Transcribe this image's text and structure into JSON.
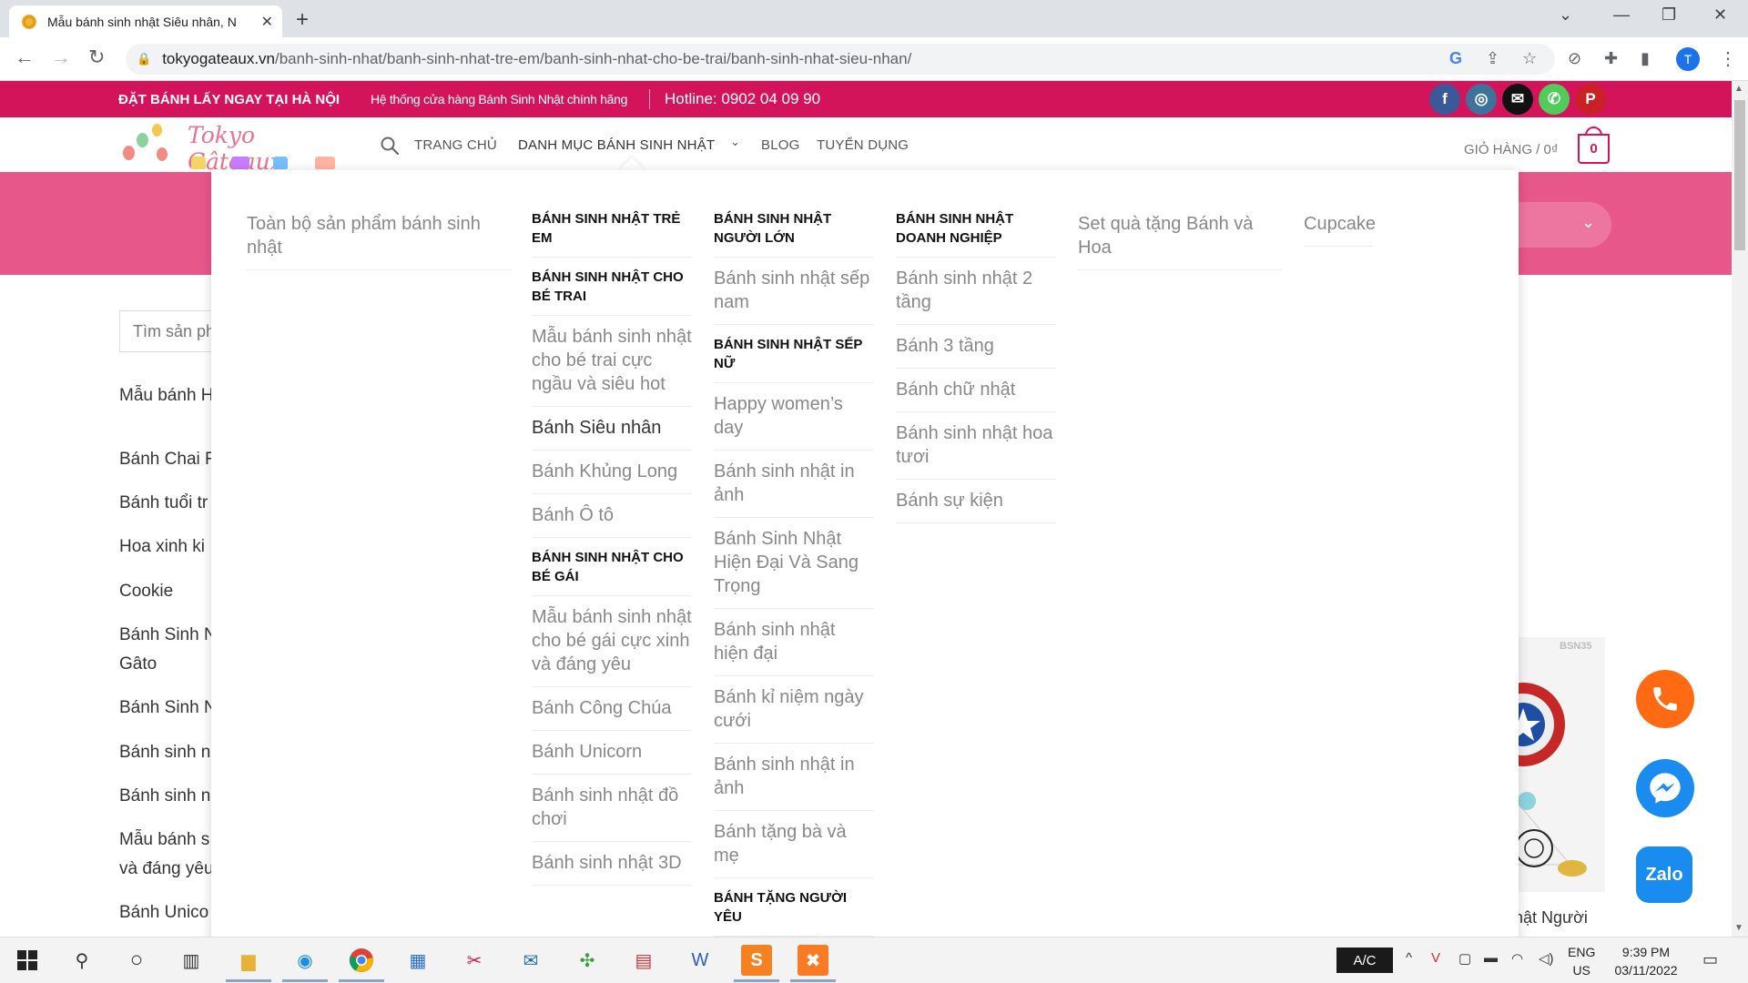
{
  "browser": {
    "tab_title": "Mẫu bánh sinh nhật Siêu nhân, N",
    "url_host": "tokyogateaux.vn",
    "url_path": "/banh-sinh-nhat/banh-sinh-nhat-tre-em/banh-sinh-nhat-cho-be-trai/banh-sinh-nhat-sieu-nhan/",
    "profile_initial": "T"
  },
  "topbar": {
    "order_text": "ĐẶT BÁNH LẤY NGAY TẠI HÀ NỘI",
    "system_text": "Hệ thống cửa hàng Bánh Sinh Nhật chính hãng",
    "hotline_text": "Hotline: 0902 04 09 90",
    "social": [
      {
        "icon": "facebook-icon",
        "glyph": "f",
        "color": "#3b5998"
      },
      {
        "icon": "instagram-icon",
        "glyph": "◎",
        "color": "#3f729b"
      },
      {
        "icon": "email-icon",
        "glyph": "✉",
        "color": "#111111"
      },
      {
        "icon": "phone-icon",
        "glyph": "✆",
        "color": "#51cb5a"
      },
      {
        "icon": "pinterest-icon",
        "glyph": "P",
        "color": "#cb2027"
      }
    ]
  },
  "header": {
    "logo_text": "Tokyo Gâteaux",
    "nav": [
      "TRANG CHỦ",
      "DANH MỤC BÁNH SINH NHẬT",
      "BLOG",
      "TUYỂN DỤNG"
    ],
    "cart_label": "GIỎ HÀNG / 0₫",
    "cart_count": "0"
  },
  "sidebar": {
    "search_placeholder": "Tìm sản ph",
    "items": [
      "Mẫu bánh H",
      "Bánh Chai R",
      "Bánh tuổi tr",
      "Hoa xinh ki",
      "Cookie",
      "Bánh Sinh N\nGâto",
      "Bánh Sinh N",
      "Bánh sinh n",
      "Bánh sinh n",
      "Mẫu bánh s\nvà đáng yêu",
      "Bánh Unico"
    ]
  },
  "product": {
    "badge": "BSN35",
    "title": "hật Người"
  },
  "mega_menu": {
    "col1": {
      "items": [
        "Toàn bộ sản phẩm bánh sinh nhật"
      ]
    },
    "col2": {
      "blocks": [
        {
          "type": "head",
          "text": "BÁNH SINH NHẬT TRẺ EM"
        },
        {
          "type": "head",
          "text": "BÁNH SINH NHẬT CHO BÉ TRAI"
        },
        {
          "type": "item",
          "text": "Mẫu bánh sinh nhật cho bé trai cực ngầu và siêu hot"
        },
        {
          "type": "item",
          "text": "Bánh Siêu nhân",
          "current": true
        },
        {
          "type": "item",
          "text": "Bánh Khủng Long"
        },
        {
          "type": "item",
          "text": "Bánh Ô tô"
        },
        {
          "type": "head",
          "text": "BÁNH SINH NHẬT CHO BÉ GÁI"
        },
        {
          "type": "item",
          "text": "Mẫu bánh sinh nhật cho bé gái cực xinh và đáng yêu"
        },
        {
          "type": "item",
          "text": "Bánh Công Chúa"
        },
        {
          "type": "item",
          "text": "Bánh Unicorn"
        },
        {
          "type": "item",
          "text": "Bánh sinh nhật đồ chơi"
        },
        {
          "type": "item",
          "text": "Bánh sinh nhật 3D"
        }
      ]
    },
    "col3": {
      "blocks": [
        {
          "type": "head",
          "text": "BÁNH SINH NHẬT NGƯỜI LỚN"
        },
        {
          "type": "item",
          "text": "Bánh sinh nhật sếp nam"
        },
        {
          "type": "head",
          "text": "BÁNH SINH NHẬT SẾP NỮ"
        },
        {
          "type": "item",
          "text": "Happy women’s day"
        },
        {
          "type": "item",
          "text": "Bánh sinh nhật in ảnh"
        },
        {
          "type": "item",
          "text": "Bánh Sinh Nhật Hiện Đại Và Sang Trọng"
        },
        {
          "type": "item",
          "text": "Bánh sinh nhật hiện đại"
        },
        {
          "type": "item",
          "text": "Bánh kỉ niệm ngày cưới"
        },
        {
          "type": "item",
          "text": "Bánh sinh nhật in ảnh"
        },
        {
          "type": "item",
          "text": "Bánh tặng bà và mẹ"
        },
        {
          "type": "head",
          "text": "BÁNH TẶNG NGƯỜI YÊU"
        }
      ]
    },
    "col4": {
      "blocks": [
        {
          "type": "head",
          "text": "BÁNH SINH NHẬT DOANH NGHIỆP"
        },
        {
          "type": "item",
          "text": "Bánh sinh nhật 2 tầng"
        },
        {
          "type": "item",
          "text": "Bánh 3 tầng"
        },
        {
          "type": "item",
          "text": "Bánh chữ nhật"
        },
        {
          "type": "item",
          "text": "Bánh sinh nhật hoa tươi"
        },
        {
          "type": "item",
          "text": "Bánh sự kiện"
        }
      ]
    },
    "col5": {
      "items": [
        "Set quà tặng Bánh và Hoa"
      ]
    },
    "col6": {
      "items": [
        "Cupcake"
      ]
    }
  },
  "floating": {
    "zalo_label": "Zalo"
  },
  "taskbar": {
    "ac_label": "A/C",
    "lang_line1": "ENG",
    "lang_line2": "US",
    "time": "9:39 PM",
    "date": "03/11/2022"
  },
  "colors": {
    "brand": "#d4145a",
    "hero": "#e8578a"
  }
}
